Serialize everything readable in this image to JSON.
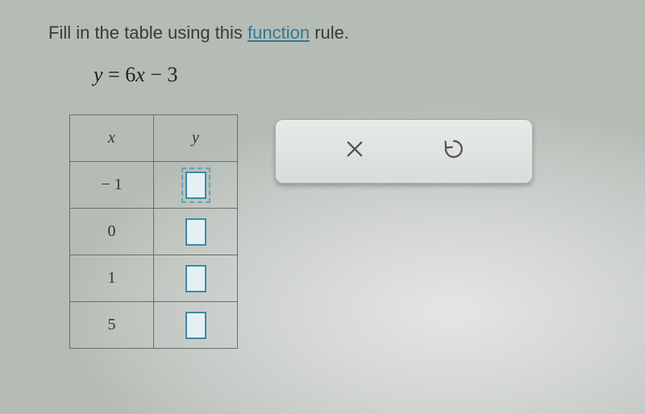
{
  "instructions": {
    "prefix": "Fill in the table using this ",
    "link_text": "function",
    "suffix": " rule."
  },
  "equation": {
    "y": "y",
    "eq": "=",
    "coef": "6",
    "x": "x",
    "minus": "−",
    "const": "3"
  },
  "table": {
    "header_x": "x",
    "header_y": "y",
    "rows": [
      {
        "x": "− 1",
        "y": ""
      },
      {
        "x": "0",
        "y": ""
      },
      {
        "x": "1",
        "y": ""
      },
      {
        "x": "5",
        "y": ""
      }
    ],
    "active_row_index": 0
  },
  "actions": {
    "clear_name": "clear",
    "undo_name": "undo"
  }
}
